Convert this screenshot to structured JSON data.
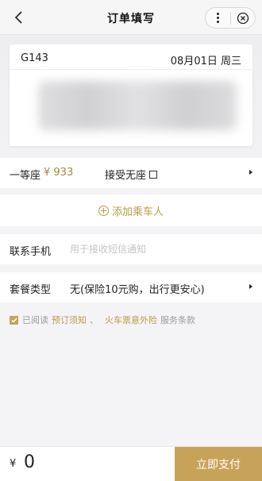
{
  "nav": {
    "title": "订单填写",
    "back_icon": "back-arrow-icon",
    "more_icon": "more-dots-icon",
    "close_icon": "close-circle-icon"
  },
  "ticket": {
    "train_no": "G143",
    "date": "08月01日 周三"
  },
  "seat": {
    "name": "一等座",
    "price": "¥ 933",
    "accept_no_seat_label": "接受无座"
  },
  "passenger": {
    "add_label": "添加乘车人"
  },
  "phone": {
    "label": "联系手机",
    "value": "",
    "placeholder": "用于接收短信通知"
  },
  "package": {
    "label": "套餐类型",
    "value": "无(保险10元购，出行更安心)"
  },
  "agreement": {
    "checked": true,
    "prefix": "已阅读",
    "link_booking": "预订须知",
    "separator": "、",
    "link_insurance": "火车票意外险",
    "link_terms": "服务条款"
  },
  "footer": {
    "currency": "¥",
    "total": "0",
    "pay_label": "立即支付"
  },
  "colors": {
    "accent": "#c7a35a",
    "link": "#b79a49",
    "price": "#9f8a3c"
  }
}
